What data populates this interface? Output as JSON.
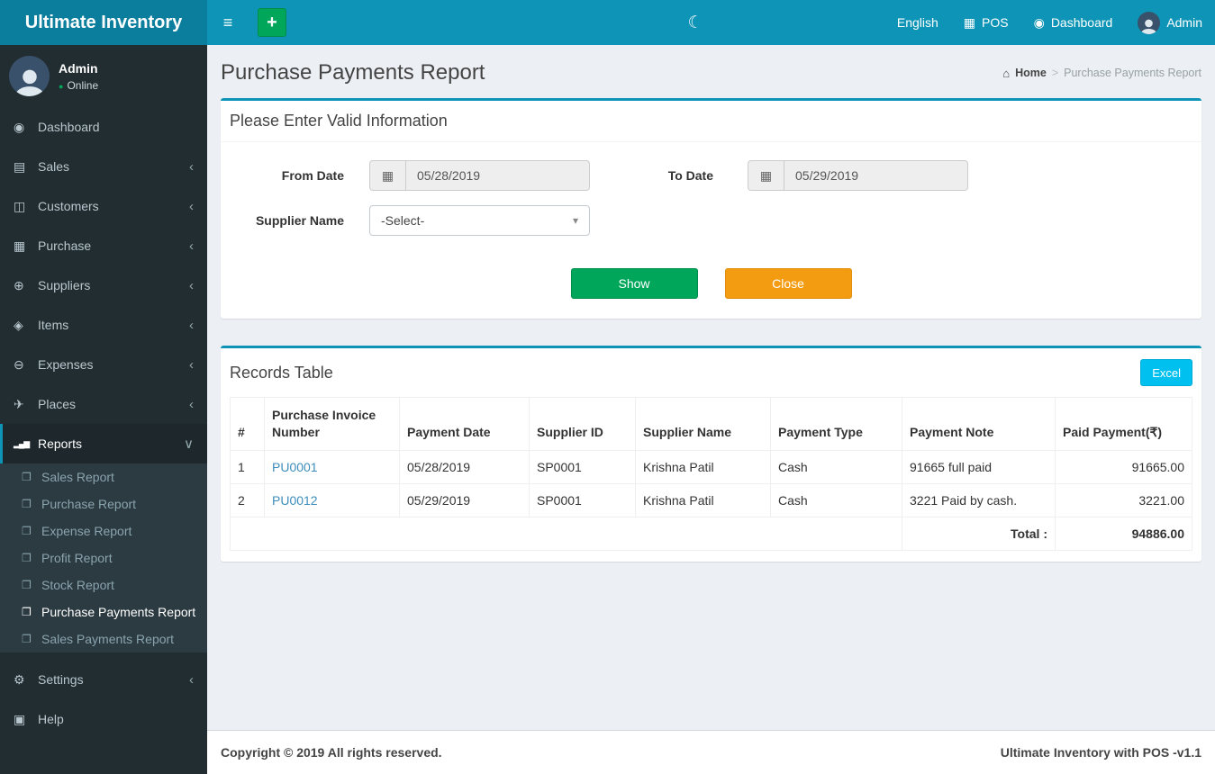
{
  "brand": {
    "title": "Ultimate Inventory"
  },
  "navbar": {
    "language": "English",
    "pos_label": "POS",
    "dashboard_label": "Dashboard",
    "user": "Admin"
  },
  "sidebar": {
    "user": {
      "name": "Admin",
      "status": "Online"
    },
    "items": [
      {
        "label": "Dashboard",
        "icon": "dashboard-icon"
      },
      {
        "label": "Sales",
        "icon": "money-icon"
      },
      {
        "label": "Customers",
        "icon": "users-icon"
      },
      {
        "label": "Purchase",
        "icon": "table-icon"
      },
      {
        "label": "Suppliers",
        "icon": "user-plus-icon"
      },
      {
        "label": "Items",
        "icon": "sitemap-icon"
      },
      {
        "label": "Expenses",
        "icon": "minus-circle-icon"
      },
      {
        "label": "Places",
        "icon": "paper-plane-icon"
      },
      {
        "label": "Reports",
        "icon": "bar-chart-icon"
      },
      {
        "label": "Settings",
        "icon": "gears-icon"
      },
      {
        "label": "Help",
        "icon": "book-icon"
      }
    ],
    "reports_submenu": [
      "Sales Report",
      "Purchase Report",
      "Expense Report",
      "Profit Report",
      "Stock Report",
      "Purchase Payments Report",
      "Sales Payments Report"
    ]
  },
  "page": {
    "title": "Purchase Payments Report",
    "breadcrumb_home": "Home",
    "breadcrumb_sep": ">",
    "breadcrumb_current": "Purchase Payments Report"
  },
  "filter": {
    "box_title": "Please Enter Valid Information",
    "from_date_label": "From Date",
    "from_date_value": "05/28/2019",
    "to_date_label": "To Date",
    "to_date_value": "05/29/2019",
    "supplier_label": "Supplier Name",
    "supplier_value": "-Select-",
    "show_label": "Show",
    "close_label": "Close"
  },
  "records": {
    "title": "Records Table",
    "excel_label": "Excel",
    "columns": [
      "#",
      "Purchase Invoice Number",
      "Payment Date",
      "Supplier ID",
      "Supplier Name",
      "Payment Type",
      "Payment Note",
      "Paid Payment(₹)"
    ],
    "rows": [
      {
        "num": "1",
        "invoice": "PU0001",
        "date": "05/28/2019",
        "supplier_id": "SP0001",
        "supplier_name": "Krishna Patil",
        "type": "Cash",
        "note": "91665 full paid",
        "paid": "91665.00"
      },
      {
        "num": "2",
        "invoice": "PU0012",
        "date": "05/29/2019",
        "supplier_id": "SP0001",
        "supplier_name": "Krishna Patil",
        "type": "Cash",
        "note": "3221 Paid by cash.",
        "paid": "3221.00"
      }
    ],
    "total_label": "Total :",
    "total_value": "94886.00"
  },
  "footer": {
    "left": "Copyright © 2019 All rights reserved.",
    "right": "Ultimate Inventory with POS -v1.1"
  },
  "colors": {
    "navbar": "#0d94b6",
    "brand": "#0a7e9c",
    "sidebar": "#222d32",
    "accent": "#0d94b6",
    "green": "#00a65a",
    "orange": "#f39c12",
    "excel_blue": "#00c0ef",
    "link": "#3c8dbc"
  },
  "icons": {
    "hamburger": "≡",
    "plus": "+",
    "moon": "☾",
    "calculator": "▦",
    "tachometer": "◉",
    "home": "⌂",
    "dashboard": "◉",
    "sales": "▤",
    "customers": "◫",
    "purchase": "▦",
    "suppliers": "⊕",
    "items": "◈",
    "expenses": "⊖",
    "places": "✈",
    "reports": "▂▄▆",
    "settings": "⚙",
    "help": "▣",
    "file": "❐",
    "angle_left": "‹",
    "angle_down": "∨",
    "calendar": "▦",
    "caret_down": "▾",
    "online_dot": "●"
  }
}
